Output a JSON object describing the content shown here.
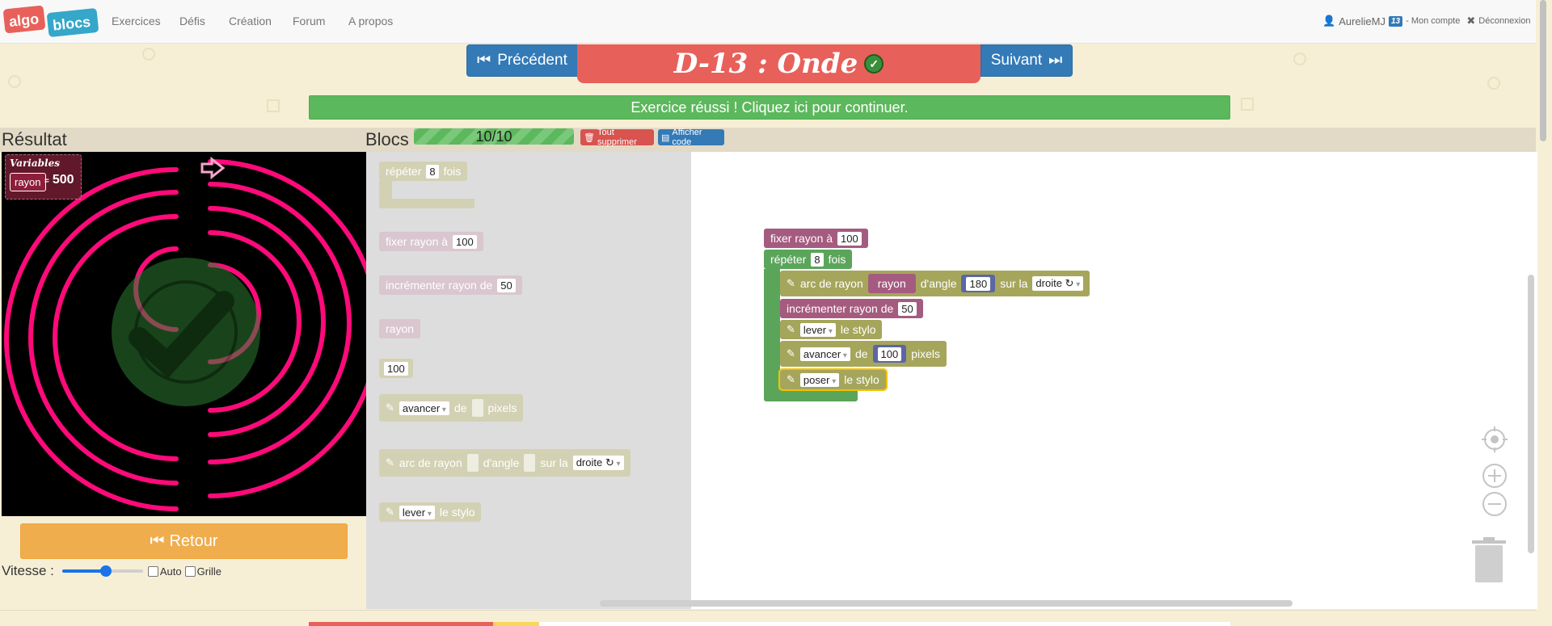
{
  "nav": {
    "logo_top": "algo",
    "logo_bottom": "blocs",
    "links": [
      "Exercices",
      "Défis",
      "Création",
      "Forum",
      "A propos"
    ],
    "user": "AurelieMJ",
    "badge": "13",
    "account": "- Mon compte",
    "logout": "Déconnexion"
  },
  "exercise": {
    "prev_label": "Précédent",
    "next_label": "Suivant",
    "title": "D-13 : Onde",
    "success_message": "Exercice réussi ! Cliquez ici pour continuer."
  },
  "result": {
    "heading": "Résultat",
    "variables_title": "Variables",
    "var_name": "rayon",
    "var_eq": "=",
    "var_value": "500",
    "retour_label": "Retour",
    "speed_label": "Vitesse :",
    "speed_level": 0.55,
    "auto_label": "Auto",
    "grid_label": "Grille"
  },
  "blocs": {
    "heading": "Blocs",
    "progress": "10/10",
    "progress_fraction": 1.0,
    "delete_all_label": "Tout supprimer",
    "show_code_label": "Afficher code"
  },
  "toolbox": {
    "repeat": {
      "before": "répéter",
      "value": "8",
      "after": "fois"
    },
    "set_radius": {
      "label": "fixer rayon à",
      "value": "100"
    },
    "increment": {
      "label": "incrémenter rayon de",
      "value": "50"
    },
    "var_rayon": "rayon",
    "num_100": "100",
    "forward": {
      "dropdown": "avancer",
      "de": "de",
      "unit": "pixels"
    },
    "arc": {
      "label": "arc de rayon",
      "angle": "d'angle",
      "side": "sur la",
      "direction": "droite ↻"
    },
    "pen": {
      "dropdown": "lever",
      "suffix": "le stylo"
    }
  },
  "workspace": {
    "set_radius": {
      "label": "fixer rayon à",
      "value": "100"
    },
    "repeat": {
      "before": "répéter",
      "value": "8",
      "after": "fois"
    },
    "arc": {
      "label": "arc de rayon",
      "var": "rayon",
      "angle": "d'angle",
      "angle_value": "180",
      "side": "sur la",
      "direction": "droite ↻"
    },
    "increment": {
      "label": "incrémenter rayon de",
      "value": "50"
    },
    "pen_up": {
      "dropdown": "lever",
      "suffix": "le stylo"
    },
    "forward": {
      "dropdown": "avancer",
      "de": "de",
      "value": "100",
      "unit": "pixels"
    },
    "pen_down": {
      "dropdown": "poser",
      "suffix": "le stylo"
    }
  },
  "icons": {
    "prev": "skip-back-icon",
    "next": "skip-forward-icon",
    "check": "check-circle-icon",
    "user": "user-icon",
    "logout": "close-icon",
    "trash": "trash-icon",
    "code": "code-icon",
    "retour": "rewind-icon",
    "turtle": "arrow-right-icon",
    "recenter": "crosshair-icon",
    "zoom_in": "plus-circle-icon",
    "zoom_out": "minus-circle-icon",
    "pencil": "pencil-icon"
  },
  "colors": {
    "accent_blue": "#337ab7",
    "title_red": "#e8605a",
    "success_green": "#5cb85c",
    "retour_orange": "#f0ad4e",
    "arc_pink": "#ff0a7a"
  }
}
